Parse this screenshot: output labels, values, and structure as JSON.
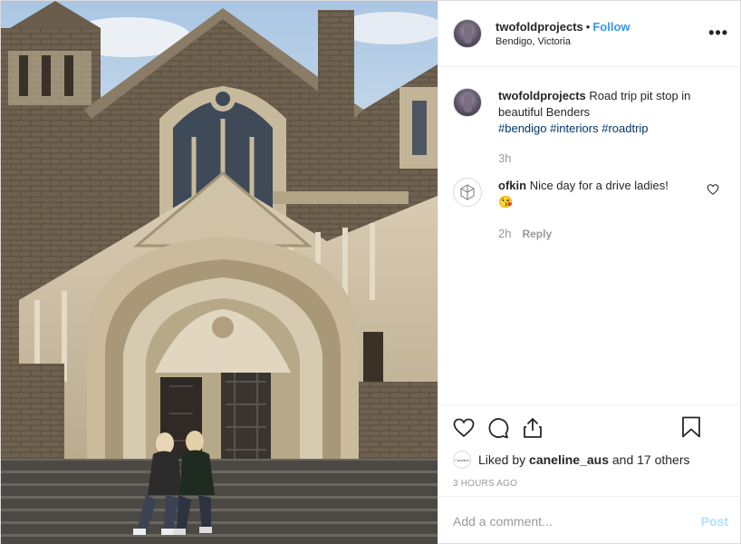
{
  "post": {
    "username": "twofoldprojects",
    "separator": "•",
    "follow_label": "Follow",
    "location": "Bendigo, Victoria",
    "more_icon": "more-horizontal-icon",
    "caption": {
      "username": "twofoldprojects",
      "text": "Road trip pit stop in beautiful Benders",
      "hashtags": [
        "#bendigo",
        "#interiors",
        "#roadtrip"
      ],
      "time": "3h"
    },
    "comments": [
      {
        "username": "ofkin",
        "text": "Nice day for a drive ladies!",
        "emoji": "😘",
        "time": "2h",
        "reply_label": "Reply"
      }
    ],
    "actions": {
      "icons": [
        "heart-icon",
        "comment-icon",
        "share-icon",
        "bookmark-icon"
      ]
    },
    "likes": {
      "avatar_text": "Caneline",
      "prefix": "Liked by",
      "user": "caneline_aus",
      "rest": "and 17 others"
    },
    "timestamp": "3 HOURS AGO",
    "add_comment": {
      "placeholder": "Add a comment...",
      "post_label": "Post"
    }
  },
  "colors": {
    "link": "#3897f0",
    "hashtag": "#003569",
    "muted": "#999999",
    "border": "#efefef"
  }
}
